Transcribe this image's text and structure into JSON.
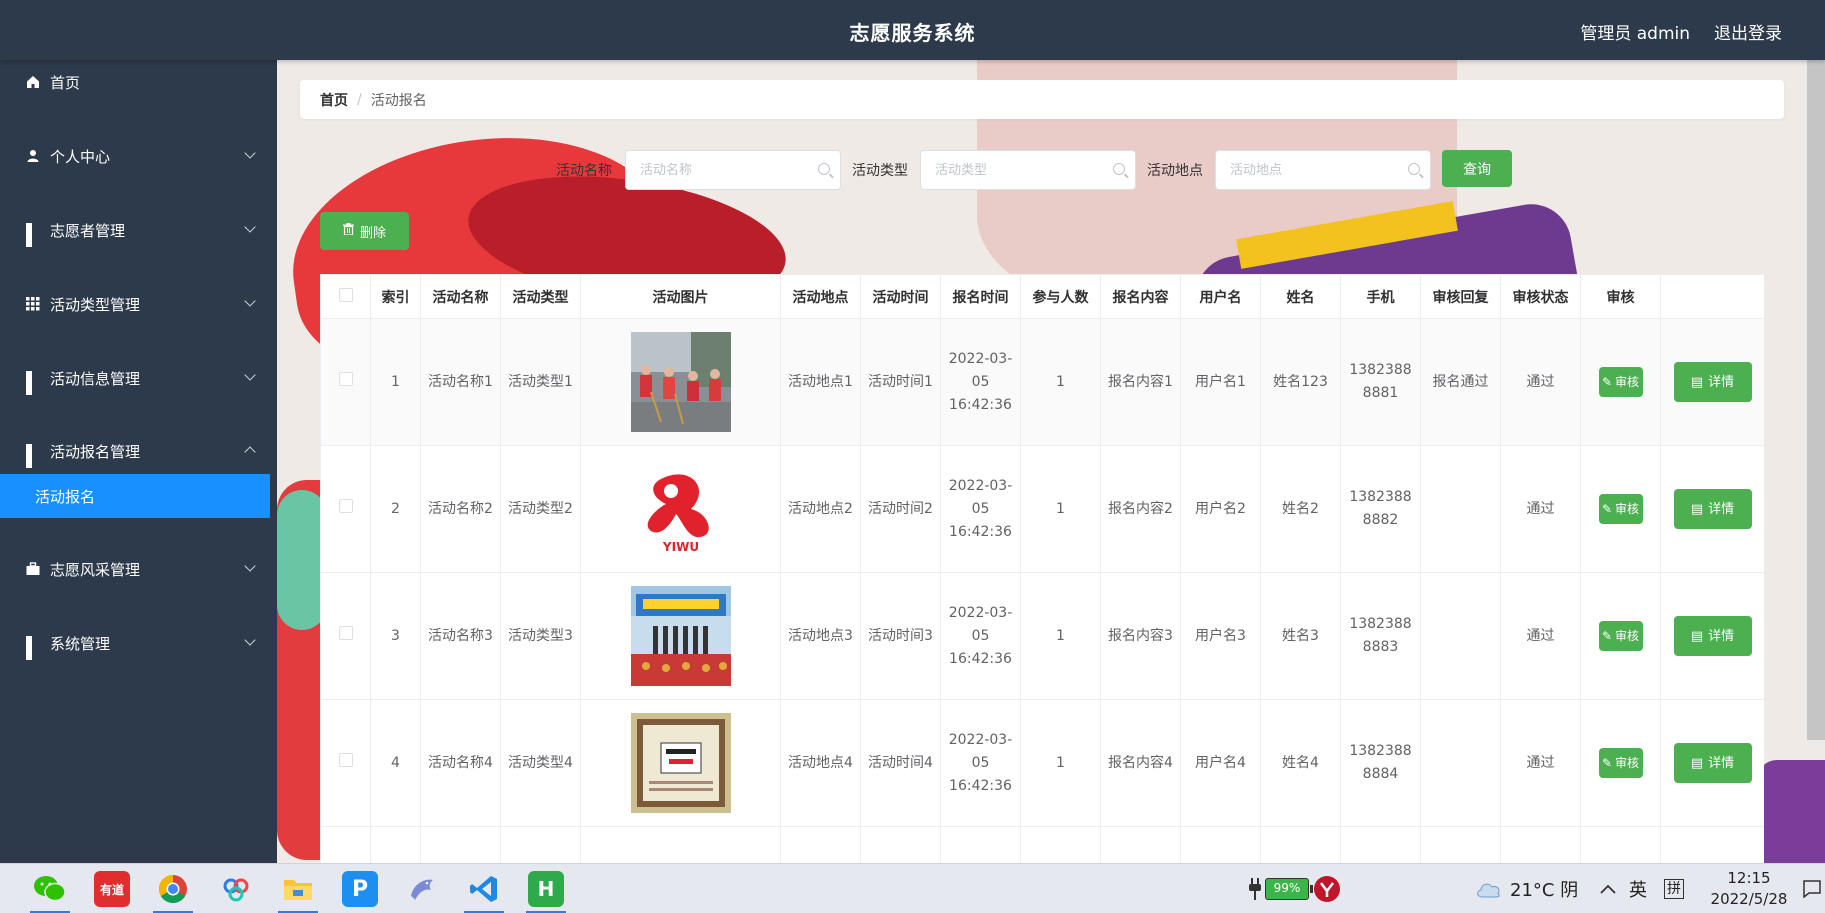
{
  "header": {
    "title": "志愿服务系统",
    "user": "管理员 admin",
    "logout": "退出登录"
  },
  "sidebar": {
    "items": [
      {
        "label": "首页",
        "icon": "home-icon"
      },
      {
        "label": "个人中心",
        "icon": "user-icon"
      },
      {
        "label": "志愿者管理",
        "icon": "grid-icon"
      },
      {
        "label": "活动类型管理",
        "icon": "grid-icon"
      },
      {
        "label": "活动信息管理",
        "icon": "grid-icon"
      },
      {
        "label": "活动报名管理",
        "icon": "grid-icon"
      },
      {
        "label": "志愿风采管理",
        "icon": "briefcase-icon"
      },
      {
        "label": "系统管理",
        "icon": "grid-icon"
      }
    ],
    "active_sub": "活动报名"
  },
  "breadcrumb": {
    "home": "首页",
    "sep": "/",
    "current": "活动报名"
  },
  "search": {
    "name_label": "活动名称",
    "name_placeholder": "活动名称",
    "type_label": "活动类型",
    "type_placeholder": "活动类型",
    "place_label": "活动地点",
    "place_placeholder": "活动地点",
    "query": "查询"
  },
  "delete_button": "删除",
  "table": {
    "headers": [
      "索引",
      "活动名称",
      "活动类型",
      "活动图片",
      "活动地点",
      "活动时间",
      "报名时间",
      "参与人数",
      "报名内容",
      "用户名",
      "姓名",
      "手机",
      "审核回复",
      "审核状态",
      "审核"
    ],
    "rows": [
      {
        "idx": "1",
        "name": "活动名称1",
        "type": "活动类型1",
        "place": "活动地点1",
        "time": "活动时间1",
        "signup": "2022-03-05 16:42:36",
        "count": "1",
        "content": "报名内容1",
        "username": "用户名1",
        "realname": "姓名123",
        "phone": "13823888881",
        "reply": "报名通过",
        "status": "通过",
        "image": "volunteers-sweeping"
      },
      {
        "idx": "2",
        "name": "活动名称2",
        "type": "活动类型2",
        "place": "活动地点2",
        "time": "活动时间2",
        "signup": "2022-03-05 16:42:36",
        "count": "1",
        "content": "报名内容2",
        "username": "用户名2",
        "realname": "姓名2",
        "phone": "13823888882",
        "reply": "",
        "status": "通过",
        "image": "yiwu-logo"
      },
      {
        "idx": "3",
        "name": "活动名称3",
        "type": "活动类型3",
        "place": "活动地点3",
        "time": "活动时间3",
        "signup": "2022-03-05 16:42:36",
        "count": "1",
        "content": "报名内容3",
        "username": "用户名3",
        "realname": "姓名3",
        "phone": "13823888883",
        "reply": "",
        "status": "通过",
        "image": "ceremony-banner"
      },
      {
        "idx": "4",
        "name": "活动名称4",
        "type": "活动类型4",
        "place": "活动地点4",
        "time": "活动时间4",
        "signup": "2022-03-05 16:42:36",
        "count": "1",
        "content": "报名内容4",
        "username": "用户名4",
        "realname": "姓名4",
        "phone": "13823888884",
        "reply": "",
        "status": "通过",
        "image": "book-poster"
      }
    ],
    "review_btn": "审核",
    "detail_btn": "详情",
    "yiwu_text": "YIWU"
  },
  "taskbar": {
    "apps": [
      "wechat-icon",
      "youdao-icon",
      "chrome-icon",
      "baidu-netdisk-icon",
      "file-explorer-icon",
      "p-app-icon",
      "dolphin-app-icon",
      "vscode-icon",
      "hbuilder-icon"
    ],
    "youdao": "有道",
    "p": "P",
    "h": "H",
    "battery": "99%",
    "weather": "21°C 阴",
    "ime1": "英",
    "ime2": "拼",
    "time": "12:15",
    "date": "2022/5/28"
  }
}
